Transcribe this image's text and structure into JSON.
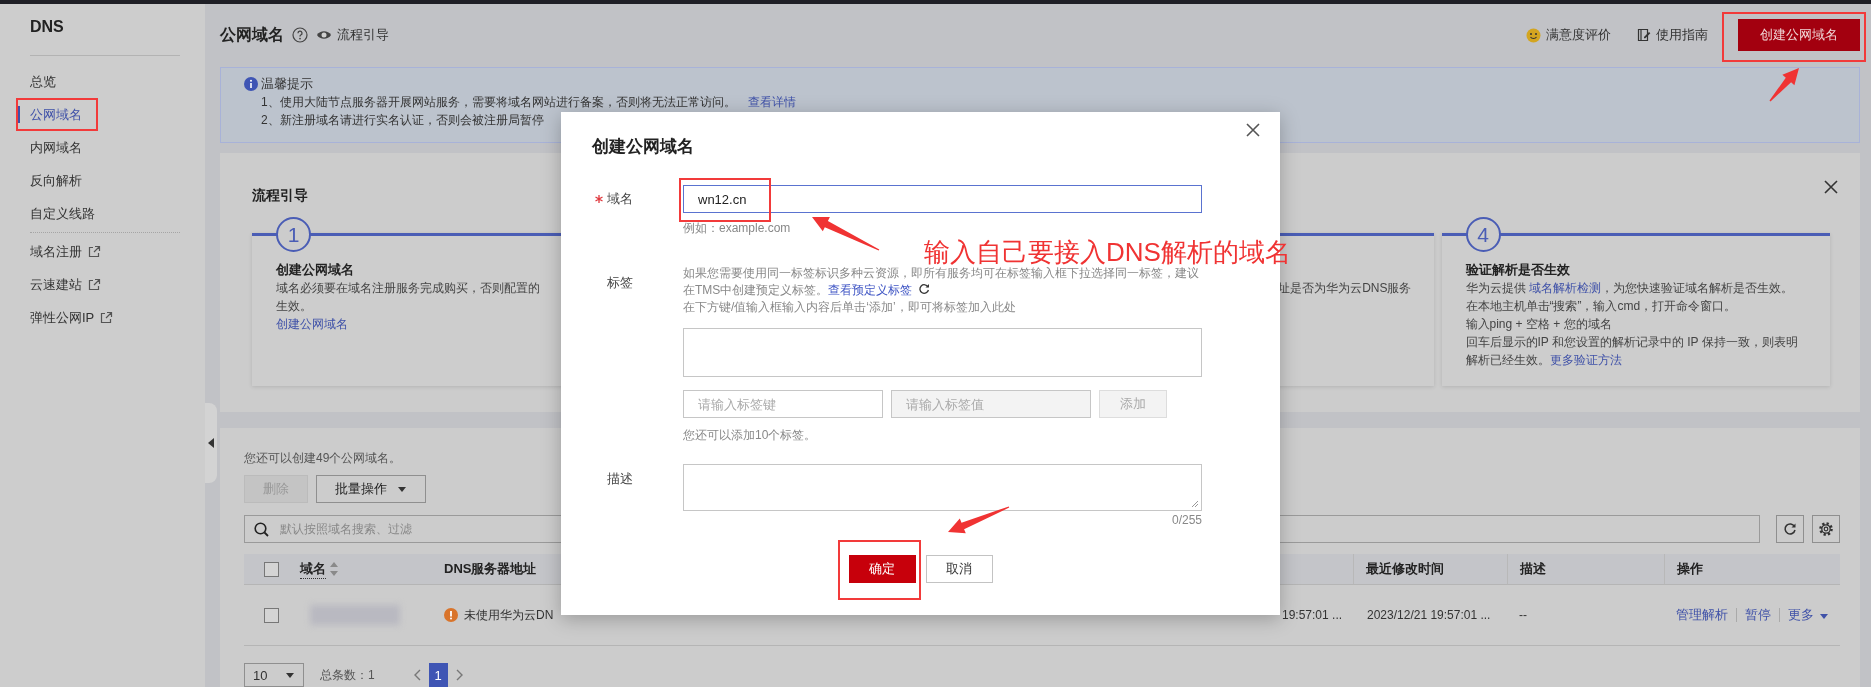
{
  "sidebar": {
    "title": "DNS",
    "items": [
      {
        "label": "总览",
        "kind": "page",
        "selected": false
      },
      {
        "label": "公网域名",
        "kind": "page",
        "selected": true
      },
      {
        "label": "内网域名",
        "kind": "page",
        "selected": false
      },
      {
        "label": "反向解析",
        "kind": "page",
        "selected": false
      },
      {
        "label": "自定义线路",
        "kind": "page",
        "selected": false
      },
      {
        "label": "域名注册",
        "kind": "external",
        "selected": false
      },
      {
        "label": "云速建站",
        "kind": "external",
        "selected": false
      },
      {
        "label": "弹性公网IP",
        "kind": "external",
        "selected": false
      }
    ]
  },
  "header": {
    "title": "公网域名",
    "guide": "流程引导",
    "feedback": "满意度评价",
    "manual": "使用指南",
    "create_button": "创建公网域名"
  },
  "notice": {
    "title": "温馨提示",
    "lines": [
      {
        "text": "1、使用大陆节点服务器开展网站服务，需要将域名网站进行备案，否则将无法正常访问。",
        "link": "查看详情"
      },
      {
        "text": "2、新注册域名请进行实名认证，否则会被注册局暂停"
      }
    ]
  },
  "flow": {
    "title": "流程引导",
    "steps": [
      {
        "number": "1",
        "title": "创建公网域名",
        "lines": [
          [
            {
              "kind": "text",
              "text": "域名必须要在域名注册服务完成购买，否则配置的"
            }
          ],
          [
            {
              "kind": "text",
              "text": "生效。"
            }
          ],
          [
            {
              "kind": "link",
              "text": "创建公网域名"
            }
          ]
        ]
      },
      {
        "lines": [
          [
            {
              "kind": "text",
              "text": "址是否为华为云DNS服务"
            }
          ]
        ]
      },
      {
        "number": "4",
        "title": "验证解析是否生效",
        "lines": [
          [
            {
              "kind": "text",
              "text": "华为云提供 "
            },
            {
              "kind": "link",
              "text": "域名解析检测"
            },
            {
              "kind": "text",
              "text": "，为您快速验证域名解析是否生效。"
            }
          ],
          [
            {
              "kind": "text",
              "text": "在本地主机单击“搜索”，输入cmd，打开命令窗口。"
            }
          ],
          [
            {
              "kind": "text",
              "text": "输入ping + 空格 + 您的域名"
            }
          ],
          [
            {
              "kind": "text",
              "text": "回车后显示的IP 和您设置的解析记录中的 IP 保持一致，则表明"
            }
          ],
          [
            {
              "kind": "text",
              "text": "解析已经生效。"
            },
            {
              "kind": "link",
              "text": "更多验证方法"
            }
          ]
        ]
      }
    ]
  },
  "domains": {
    "quota": "您还可以创建49个公网域名。",
    "delete_button": {
      "label": "删除",
      "disabled": true
    },
    "batch_button": {
      "label": "批量操作",
      "disabled": false
    },
    "search": {
      "placeholder": "默认按照域名搜索、过滤"
    },
    "all_selected": false,
    "columns": [
      {
        "label": "域名",
        "sortable": true
      },
      {
        "label": "DNS服务器地址",
        "sortable": false
      },
      {
        "label": "最近修改时间",
        "sortable": false
      },
      {
        "label": "描述",
        "sortable": false
      },
      {
        "label": "操作",
        "sortable": false
      }
    ],
    "rows": [
      {
        "selected": false,
        "domain_redacted": true,
        "dns_status": "未使用华为云DN",
        "created": "19:57:01 ...",
        "modified": "2023/12/21 19:57:01 ...",
        "description": "--",
        "actions": [
          {
            "label": "管理解析",
            "menu": false
          },
          {
            "label": "暂停",
            "menu": false
          },
          {
            "label": "更多",
            "menu": true
          }
        ]
      }
    ],
    "pagination": {
      "page_size": "10",
      "total": "总条数：1",
      "pages": [
        {
          "label": "1",
          "selected": true
        }
      ]
    }
  },
  "dialog": {
    "title": "创建公网域名",
    "fields": [
      {
        "kind": "text",
        "label": "域名",
        "required": true,
        "value": "wn12.cn",
        "hint": "例如：example.com"
      },
      {
        "kind": "tags",
        "label": "标签",
        "required": false,
        "help": [
          [
            {
              "kind": "text",
              "text": "如果您需要使用同一标签标识多种云资源，即所有服务均可在标签输入框下拉选择同一标签，建议"
            }
          ],
          [
            {
              "kind": "text",
              "text": "在TMS中创建预定义标签。"
            },
            {
              "kind": "link",
              "text": "查看预定义标签"
            }
          ],
          [
            {
              "kind": "text",
              "text": "在下方键/值输入框输入内容后单击‘添加’，即可将标签加入此处"
            }
          ]
        ],
        "key_field": {
          "placeholder": "请输入标签键",
          "disabled": false
        },
        "value_field": {
          "placeholder": "请输入标签值",
          "disabled": true
        },
        "add_button": {
          "label": "添加",
          "disabled": true
        },
        "remaining": "您还可以添加10个标签。"
      },
      {
        "kind": "textarea",
        "label": "描述",
        "required": false,
        "counter": "0/255"
      }
    ],
    "buttons": [
      {
        "label": "确定",
        "primary": true
      },
      {
        "label": "取消",
        "primary": false
      }
    ]
  },
  "annotation": {
    "text": "输入自己要接入DNS解析的域名"
  }
}
